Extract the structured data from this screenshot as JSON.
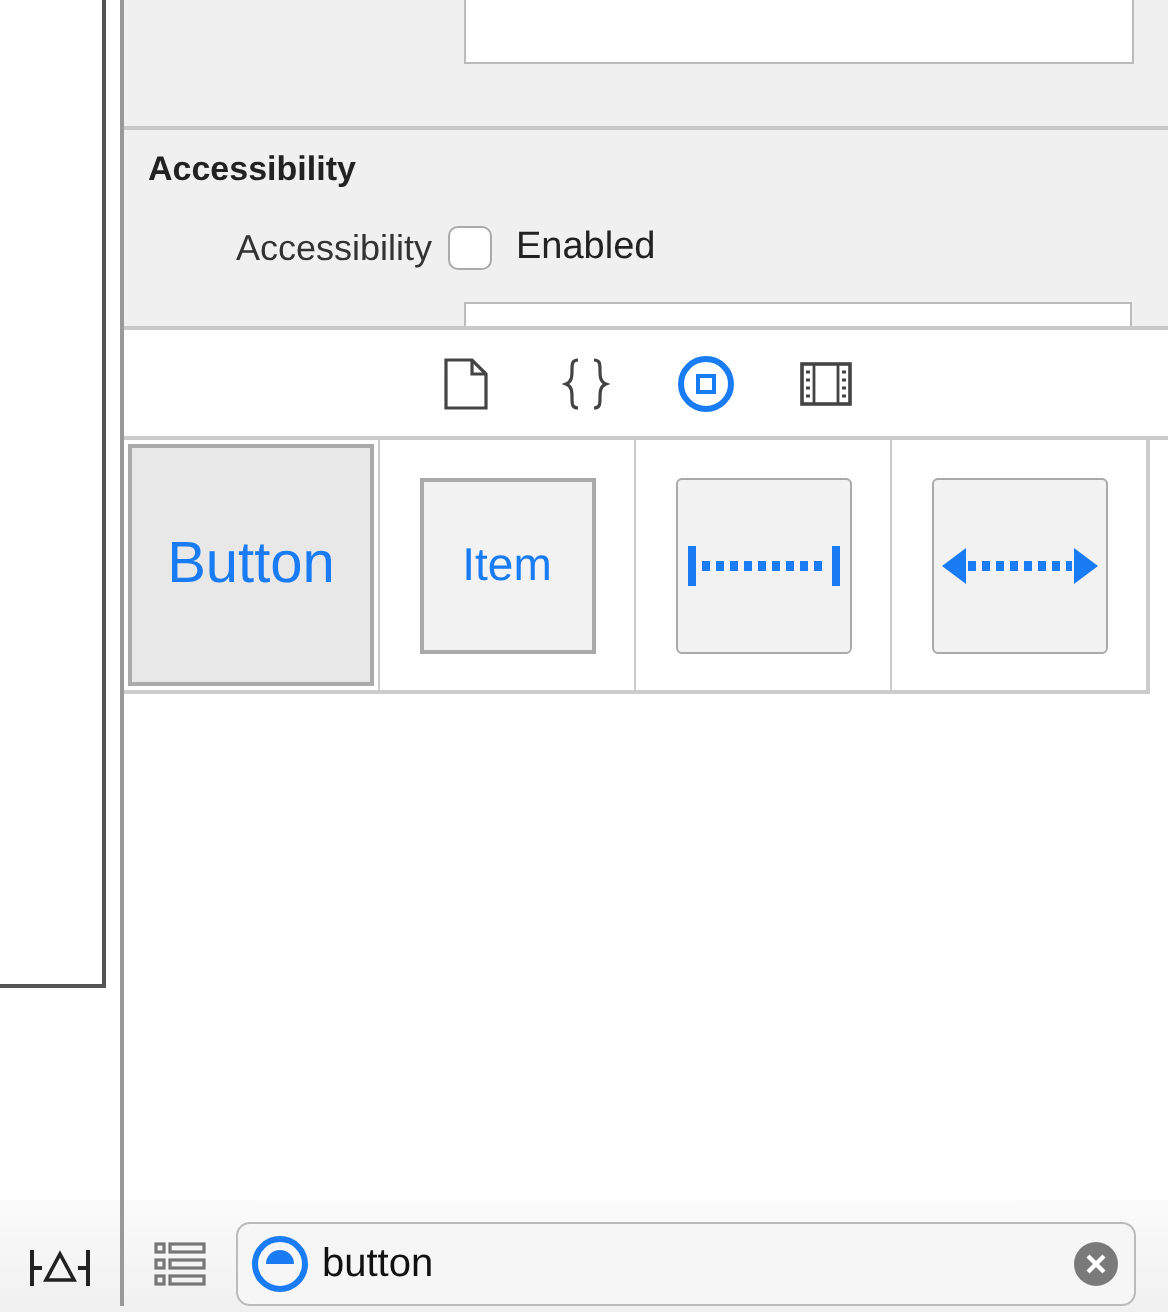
{
  "inspector": {
    "section_title": "Accessibility",
    "accessibility_row": {
      "label": "Accessibility",
      "checkbox_label": "Enabled",
      "checked": false
    }
  },
  "library_tabs": [
    {
      "kind": "file",
      "selected": false
    },
    {
      "kind": "braces",
      "selected": false
    },
    {
      "kind": "object",
      "selected": true
    },
    {
      "kind": "media",
      "selected": false
    }
  ],
  "library_items": [
    {
      "kind": "button",
      "label": "Button",
      "selected": true
    },
    {
      "kind": "item",
      "label": "Item",
      "selected": false
    },
    {
      "kind": "fixed-space",
      "selected": false
    },
    {
      "kind": "flexible-space",
      "selected": false
    }
  ],
  "filter": {
    "value": "button"
  }
}
